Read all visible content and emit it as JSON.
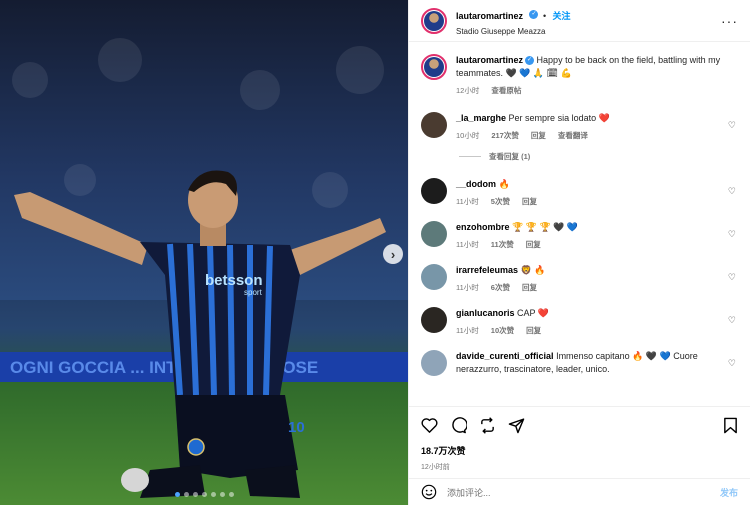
{
  "header": {
    "username": "lautaromartinez",
    "follow": "关注",
    "location": "Stadio Giuseppe Meazza",
    "more_icon": "more-horizontal-icon"
  },
  "photo": {
    "board_text": "OGNI GOCCIA ... INTER ... DION SOSE",
    "sponsor": "betsson",
    "sponsor_sub": "sport",
    "shirt_number": "10",
    "dot_count": 7,
    "active_dot": 1
  },
  "caption": {
    "username": "lautaromartinez",
    "text": "Happy to be back on the field, battling with my teammates. 🖤 💙 🙏 🗓 💪",
    "time": "12小时",
    "translate": "查看原帖"
  },
  "comments": [
    {
      "username": "_la_marghe",
      "text": "Per sempre sia lodato ❤️",
      "time": "10小时",
      "likes": "217次赞",
      "reply": "回复",
      "translate": "查看翻译"
    },
    {
      "username": "__dodom",
      "text": "🔥",
      "time": "11小时",
      "likes": "5次赞",
      "reply": "回复"
    },
    {
      "username": "enzohombre",
      "text": "🏆 🏆 🏆 🖤 💙",
      "time": "11小时",
      "likes": "11次赞",
      "reply": "回复"
    },
    {
      "username": "irarrefeleumas",
      "text": "🦁 🔥",
      "time": "11小时",
      "likes": "6次赞",
      "reply": "回复"
    },
    {
      "username": "gianlucanoris",
      "text": "CAP ❤️",
      "time": "11小时",
      "likes": "10次赞",
      "reply": "回复"
    },
    {
      "username": "davide_curenti_official",
      "text": "Immenso capitano 🔥 🖤 💙 Cuore nerazzurro, trascinatore, leader, unico.",
      "time": "",
      "likes": "",
      "reply": ""
    }
  ],
  "replies_link": "查看回复 (1)",
  "footer": {
    "likes": "18.7万次赞",
    "time": "12小时前",
    "comment_placeholder": "添加评论...",
    "post_label": "发布"
  }
}
